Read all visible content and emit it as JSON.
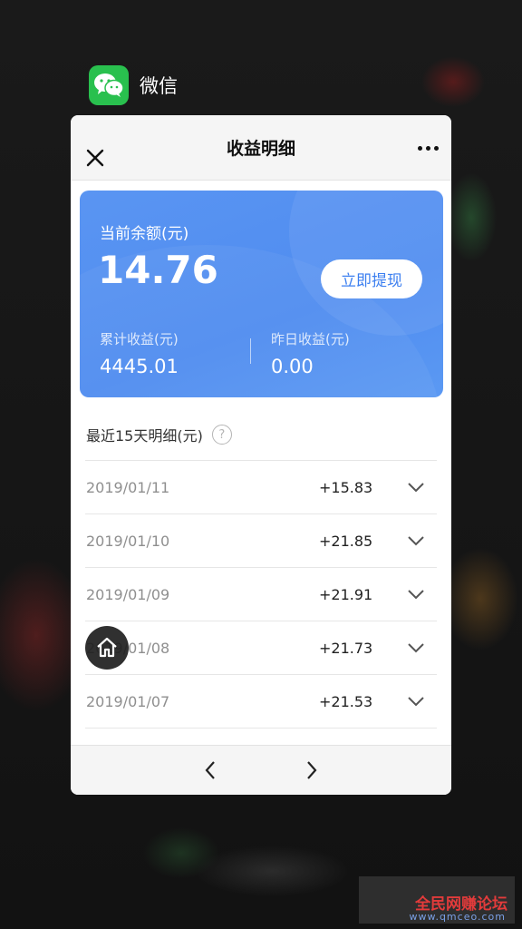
{
  "app": {
    "name": "微信",
    "icon": "wechat-icon"
  },
  "navbar": {
    "title": "收益明细",
    "close_icon": "close-icon",
    "more_icon": "more-icon"
  },
  "balance": {
    "current_label": "当前余额(元)",
    "current_value": "14.76",
    "withdraw_label": "立即提现",
    "total_label": "累计收益(元)",
    "total_value": "4445.01",
    "yesterday_label": "昨日收益(元)",
    "yesterday_value": "0.00"
  },
  "details": {
    "title": "最近15天明细(元)",
    "help": "?",
    "rows": [
      {
        "date": "2019/01/11",
        "amount": "+15.83"
      },
      {
        "date": "2019/01/10",
        "amount": "+21.85"
      },
      {
        "date": "2019/01/09",
        "amount": "+21.91"
      },
      {
        "date": "2019/01/08",
        "amount": "+21.73"
      },
      {
        "date": "2019/01/07",
        "amount": "+21.53"
      }
    ]
  },
  "bottom_nav": {
    "back_icon": "chevron-left-icon",
    "forward_icon": "chevron-right-icon"
  },
  "floating": {
    "home_icon": "home-icon"
  },
  "watermark": {
    "text": "全民网赚论坛",
    "sub": "www.qmceo.com"
  },
  "colors": {
    "accent": "#4f8cf0",
    "wechat_green": "#29c04e",
    "button_text": "#3c7ff0"
  }
}
